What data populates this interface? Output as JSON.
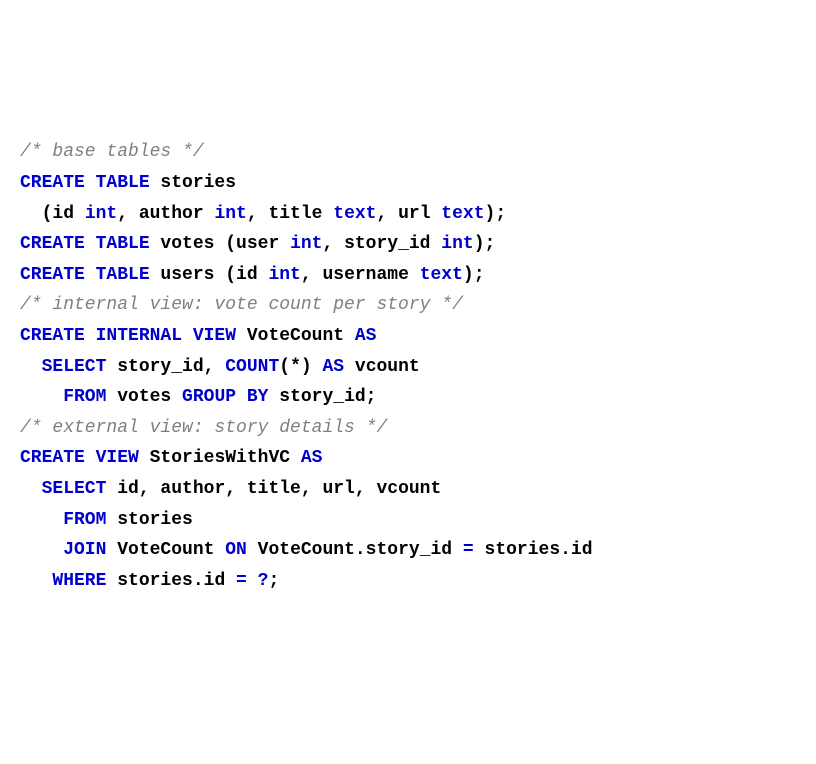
{
  "code": {
    "l1_c1": "/* base tables */",
    "l2_k1": "CREATE TABLE",
    "l2_t1": " stories",
    "l3_t1": "  (id ",
    "l3_k1": "int",
    "l3_t2": ", author ",
    "l3_k2": "int",
    "l3_t3": ", title ",
    "l3_k3": "text",
    "l3_t4": ", url ",
    "l3_k4": "text",
    "l3_t5": ");",
    "l4_k1": "CREATE TABLE",
    "l4_t1": " votes (user ",
    "l4_k2": "int",
    "l4_t2": ", story_id ",
    "l4_k3": "int",
    "l4_t3": ");",
    "l5_k1": "CREATE TABLE",
    "l5_t1": " users (id ",
    "l5_k2": "int",
    "l5_t2": ", username ",
    "l5_k3": "text",
    "l5_t3": ");",
    "l6_c1": "/* internal view: vote count per story */",
    "l7_k1": "CREATE INTERNAL VIEW",
    "l7_t1": " VoteCount ",
    "l7_k2": "AS",
    "l8_k1": "  SELECT",
    "l8_t1": " story_id, ",
    "l8_k2": "COUNT",
    "l8_t2": "(*) ",
    "l8_k3": "AS",
    "l8_t3": " vcount",
    "l9_k1": "    FROM",
    "l9_t1": " votes ",
    "l9_k2": "GROUP BY",
    "l9_t2": " story_id;",
    "l10_c1": "/* external view: story details */",
    "l11_k1": "CREATE VIEW",
    "l11_t1": " StoriesWithVC ",
    "l11_k2": "AS",
    "l12_k1": "  SELECT",
    "l12_t1": " id, author, title, url, vcount",
    "l13_k1": "    FROM",
    "l13_t1": " stories",
    "l14_k1": "    JOIN",
    "l14_t1": " VoteCount ",
    "l14_k2": "ON",
    "l14_t2": " VoteCount.story_id ",
    "l14_op1": "=",
    "l14_t3": " stories.id",
    "l15_k1": "   WHERE",
    "l15_t1": " stories.id ",
    "l15_op1": "=",
    "l15_t2": " ",
    "l15_op2": "?",
    "l15_t3": ";"
  }
}
